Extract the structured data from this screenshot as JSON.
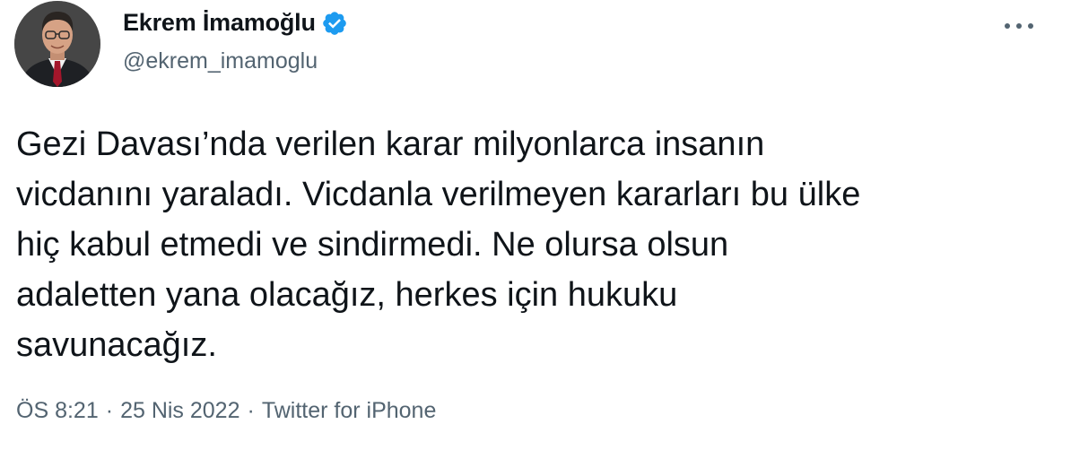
{
  "author": {
    "display_name": "Ekrem İmamoğlu",
    "handle": "@ekrem_imamoglu",
    "verified": true,
    "avatar_icon": "profile-photo"
  },
  "more_icon": "more-horizontal-icon",
  "tweet": {
    "text": "Gezi Davası’nda verilen karar milyonlarca insanın\nvicdanını yaraladı. Vicdanla verilmeyen kararları bu ülke\nhiç kabul etmedi ve sindirmedi. Ne olursa olsun\nadaletten yana olacağız, herkes için hukuku\nsavunacağız."
  },
  "meta": {
    "time": "ÖS 8:21",
    "date": "25 Nis 2022",
    "source": "Twitter for iPhone",
    "separator": "·"
  },
  "colors": {
    "text_primary": "#0f1419",
    "text_secondary": "#536471",
    "verified_blue": "#1d9bf0"
  }
}
